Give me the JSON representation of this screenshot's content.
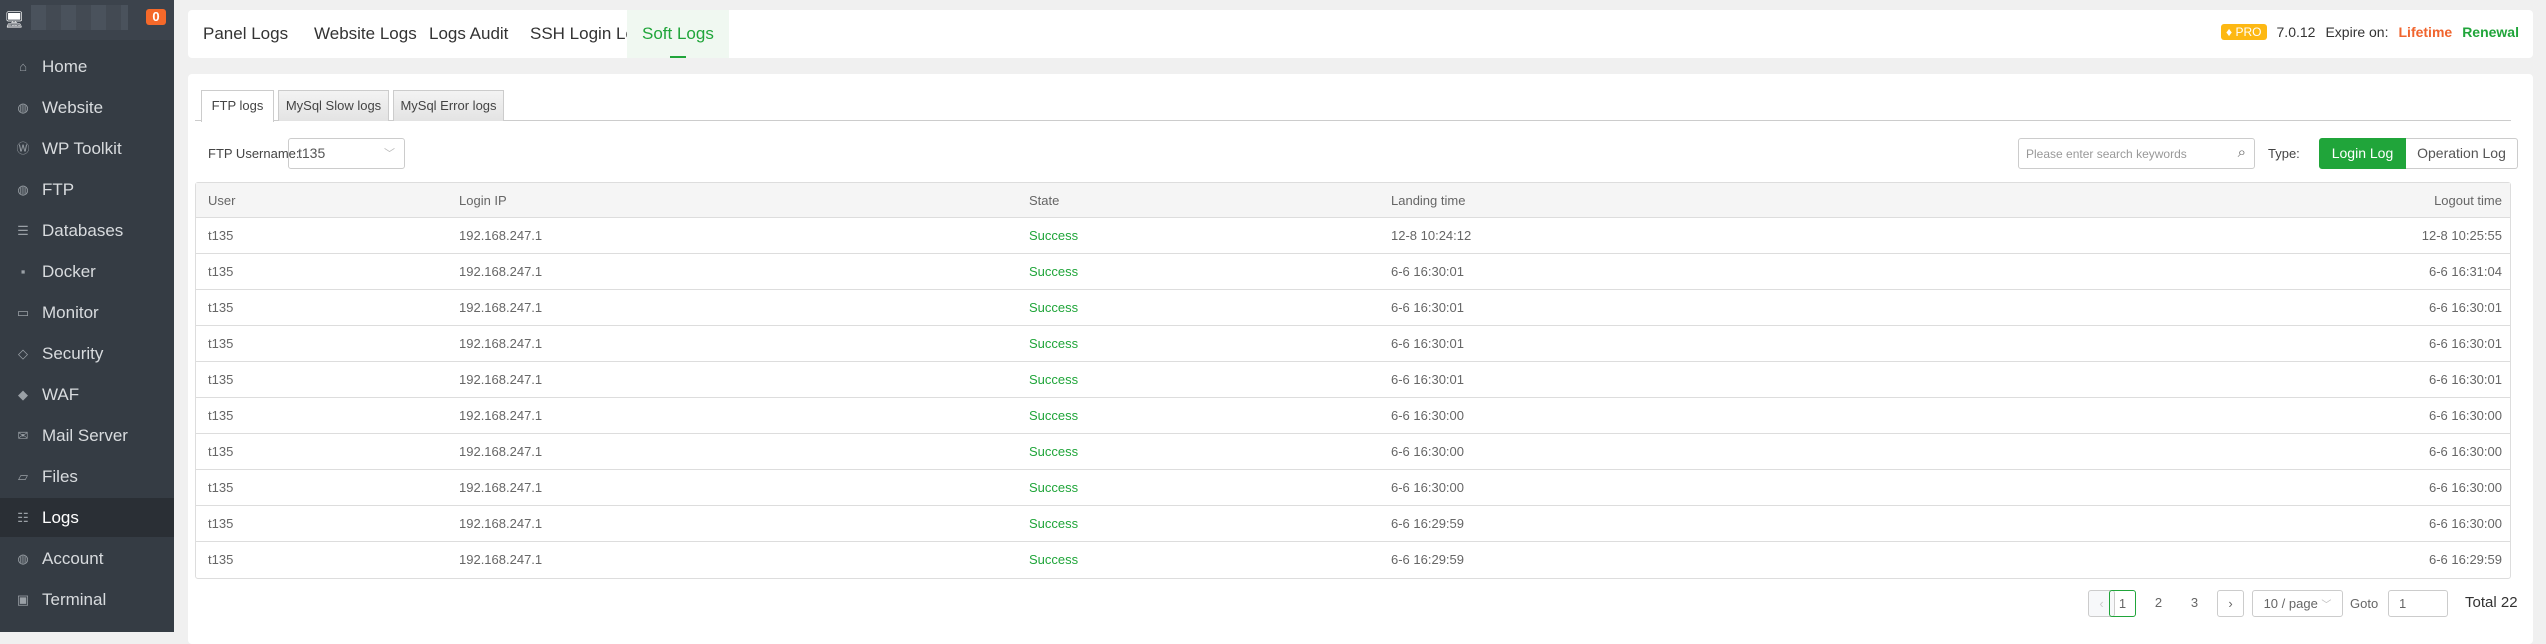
{
  "sidebar": {
    "badge": "0",
    "items": [
      {
        "label": "Home",
        "icon": "home-icon"
      },
      {
        "label": "Website",
        "icon": "globe-icon"
      },
      {
        "label": "WP Toolkit",
        "icon": "wordpress-icon"
      },
      {
        "label": "FTP",
        "icon": "ftp-icon"
      },
      {
        "label": "Databases",
        "icon": "database-icon"
      },
      {
        "label": "Docker",
        "icon": "docker-icon"
      },
      {
        "label": "Monitor",
        "icon": "monitor-icon"
      },
      {
        "label": "Security",
        "icon": "shield-icon"
      },
      {
        "label": "WAF",
        "icon": "waf-icon"
      },
      {
        "label": "Mail Server",
        "icon": "mail-icon"
      },
      {
        "label": "Files",
        "icon": "folder-icon"
      },
      {
        "label": "Logs",
        "icon": "logs-icon"
      },
      {
        "label": "Account",
        "icon": "globe-icon"
      },
      {
        "label": "Terminal",
        "icon": "terminal-icon"
      }
    ]
  },
  "topbar": {
    "tabs": [
      "Panel Logs",
      "Website Logs",
      "Logs Audit",
      "SSH Login Logs",
      "Soft Logs"
    ],
    "pro": "PRO",
    "version": "7.0.12",
    "expire_label": "Expire on:",
    "expire_value": "Lifetime",
    "renewal": "Renewal"
  },
  "subtabs": [
    "FTP logs",
    "MySql Slow logs",
    "MySql Error logs"
  ],
  "filter": {
    "username_label": "FTP Username:",
    "username_value": "t135",
    "search_placeholder": "Please enter search keywords",
    "type_label": "Type:",
    "login_log": "Login Log",
    "operation_log": "Operation Log"
  },
  "table": {
    "headers": [
      "User",
      "Login IP",
      "State",
      "Landing time",
      "Logout time"
    ],
    "rows": [
      [
        "t135",
        "192.168.247.1",
        "Success",
        "12-8 10:24:12",
        "12-8 10:25:55"
      ],
      [
        "t135",
        "192.168.247.1",
        "Success",
        "6-6 16:30:01",
        "6-6 16:31:04"
      ],
      [
        "t135",
        "192.168.247.1",
        "Success",
        "6-6 16:30:01",
        "6-6 16:30:01"
      ],
      [
        "t135",
        "192.168.247.1",
        "Success",
        "6-6 16:30:01",
        "6-6 16:30:01"
      ],
      [
        "t135",
        "192.168.247.1",
        "Success",
        "6-6 16:30:01",
        "6-6 16:30:01"
      ],
      [
        "t135",
        "192.168.247.1",
        "Success",
        "6-6 16:30:00",
        "6-6 16:30:00"
      ],
      [
        "t135",
        "192.168.247.1",
        "Success",
        "6-6 16:30:00",
        "6-6 16:30:00"
      ],
      [
        "t135",
        "192.168.247.1",
        "Success",
        "6-6 16:30:00",
        "6-6 16:30:00"
      ],
      [
        "t135",
        "192.168.247.1",
        "Success",
        "6-6 16:29:59",
        "6-6 16:30:00"
      ],
      [
        "t135",
        "192.168.247.1",
        "Success",
        "6-6 16:29:59",
        "6-6 16:29:59"
      ]
    ]
  },
  "pagination": {
    "pages": [
      "1",
      "2",
      "3"
    ],
    "per_page": "10 / page",
    "goto_label": "Goto",
    "goto_value": "1",
    "total": "Total 22"
  }
}
